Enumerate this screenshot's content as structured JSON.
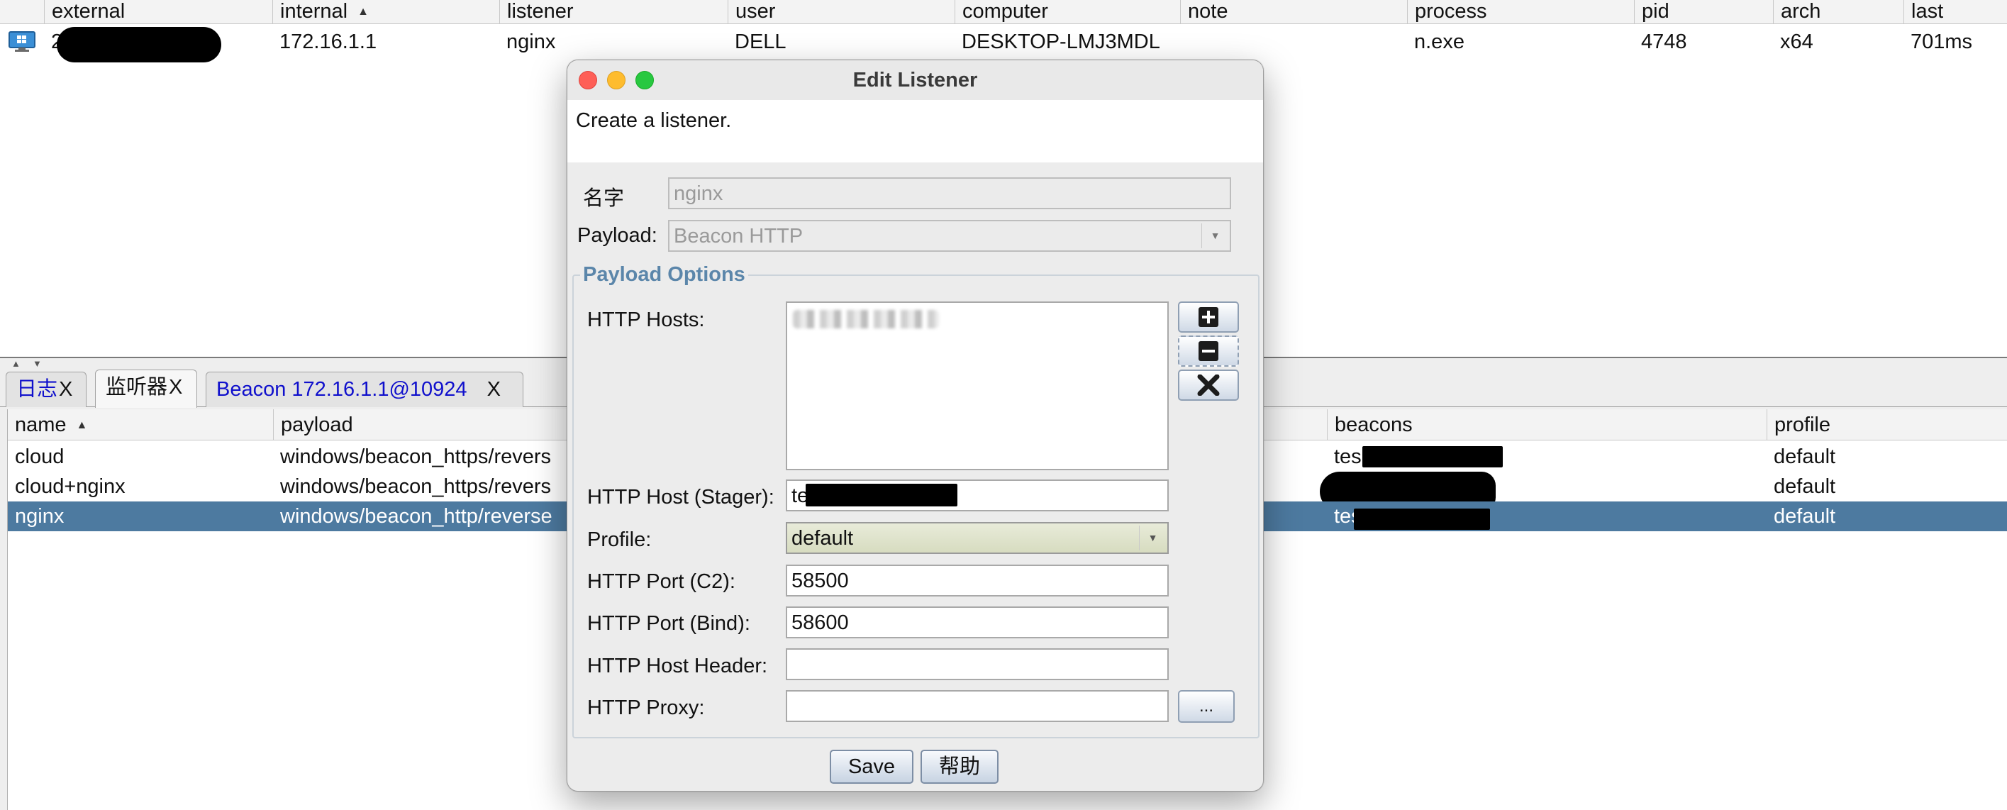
{
  "sessions_table": {
    "columns": [
      "external",
      "internal",
      "listener",
      "user",
      "computer",
      "note",
      "process",
      "pid",
      "arch",
      "last"
    ],
    "sort_column": "internal",
    "rows": [
      {
        "external": "2",
        "internal": "172.16.1.1",
        "listener": "nginx",
        "user": "DELL",
        "computer": "DESKTOP-LMJ3MDL",
        "note": "",
        "process": "n.exe",
        "pid": "4748",
        "arch": "x64",
        "last": "701ms"
      }
    ]
  },
  "tabs": [
    {
      "label": "日志",
      "close": "X"
    },
    {
      "label": "监听器",
      "close": "X",
      "active": true
    },
    {
      "label": "Beacon 172.16.1.1@10924",
      "close": "X"
    }
  ],
  "listeners_table": {
    "columns": [
      "name",
      "payload",
      "beacons",
      "profile"
    ],
    "sort_column": "name",
    "rows": [
      {
        "name": "cloud",
        "payload": "windows/beacon_https/revers",
        "beacons": "tes",
        "profile": "default"
      },
      {
        "name": "cloud+nginx",
        "payload": "windows/beacon_https/revers",
        "beacons": "",
        "profile": "default"
      },
      {
        "name": "nginx",
        "payload": "windows/beacon_http/reverse",
        "beacons": "tes",
        "profile": "default",
        "selected": true
      }
    ]
  },
  "dialog": {
    "title": "Edit Listener",
    "description": "Create a listener.",
    "name_label": "名字",
    "name_value": "nginx",
    "payload_label": "Payload:",
    "payload_value": "Beacon HTTP",
    "options_title": "Payload Options",
    "http_hosts_label": "HTTP Hosts:",
    "http_hosts_value": "",
    "stager_label": "HTTP Host (Stager):",
    "stager_value": "te",
    "profile_label": "Profile:",
    "profile_value": "default",
    "port_c2_label": "HTTP Port (C2):",
    "port_c2_value": "58500",
    "port_bind_label": "HTTP Port (Bind):",
    "port_bind_value": "58600",
    "host_header_label": "HTTP Host Header:",
    "host_header_value": "",
    "proxy_label": "HTTP Proxy:",
    "proxy_value": "",
    "proxy_button": "...",
    "save_button": "Save",
    "help_button": "帮助"
  },
  "icons": {
    "session": "windows-monitor-icon",
    "add": "plus-icon",
    "remove": "minus-icon",
    "clear": "x-icon"
  },
  "colors": {
    "selected_row": "#4d7aa0",
    "options_title": "#5b86aa",
    "tab_link": "#1010cc",
    "close_light": "#fe5f57",
    "minimize_light": "#febc2e",
    "zoom_light": "#28c840"
  }
}
